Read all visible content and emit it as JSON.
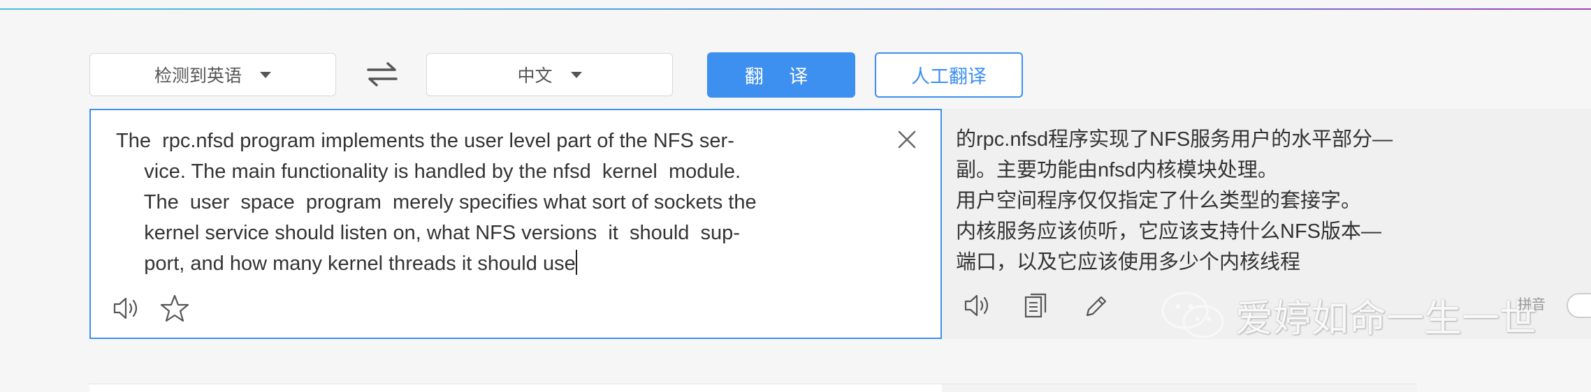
{
  "toolbar": {
    "source_lang": "检测到英语",
    "target_lang": "中文",
    "translate_label": "翻 译",
    "human_label": "人工翻译",
    "swap_icon": "swap-arrows-icon"
  },
  "source": {
    "lines": [
      "The  rpc.nfsd program implements the user level part of the NFS ser-",
      "     vice. The main functionality is handled by the nfsd  kernel  module.",
      "     The  user  space  program  merely specifies what sort of sockets the",
      "     kernel service should listen on, what NFS versions  it  should  sup-",
      "     port, and how many kernel threads it should use"
    ],
    "icons": [
      "speaker-icon",
      "star-icon",
      "close-icon"
    ]
  },
  "result": {
    "lines": [
      "的rpc.nfsd程序实现了NFS服务用户的水平部分—",
      "副。主要功能由nfsd内核模块处理。",
      "用户空间程序仅仅指定了什么类型的套接字。",
      "内核服务应该侦听，它应该支持什么NFS版本—",
      "端口，以及它应该使用多少个内核线程"
    ],
    "icons": [
      "speaker-icon",
      "copy-icon",
      "edit-icon"
    ],
    "pinyin_label": "拼音"
  },
  "watermark": {
    "text": "爱婷如命一生一世",
    "icon": "wechat-logo-icon"
  },
  "colors": {
    "accent": "#3d8ff0",
    "background": "#f6f6f7",
    "result_bg": "#f0f0f1"
  }
}
